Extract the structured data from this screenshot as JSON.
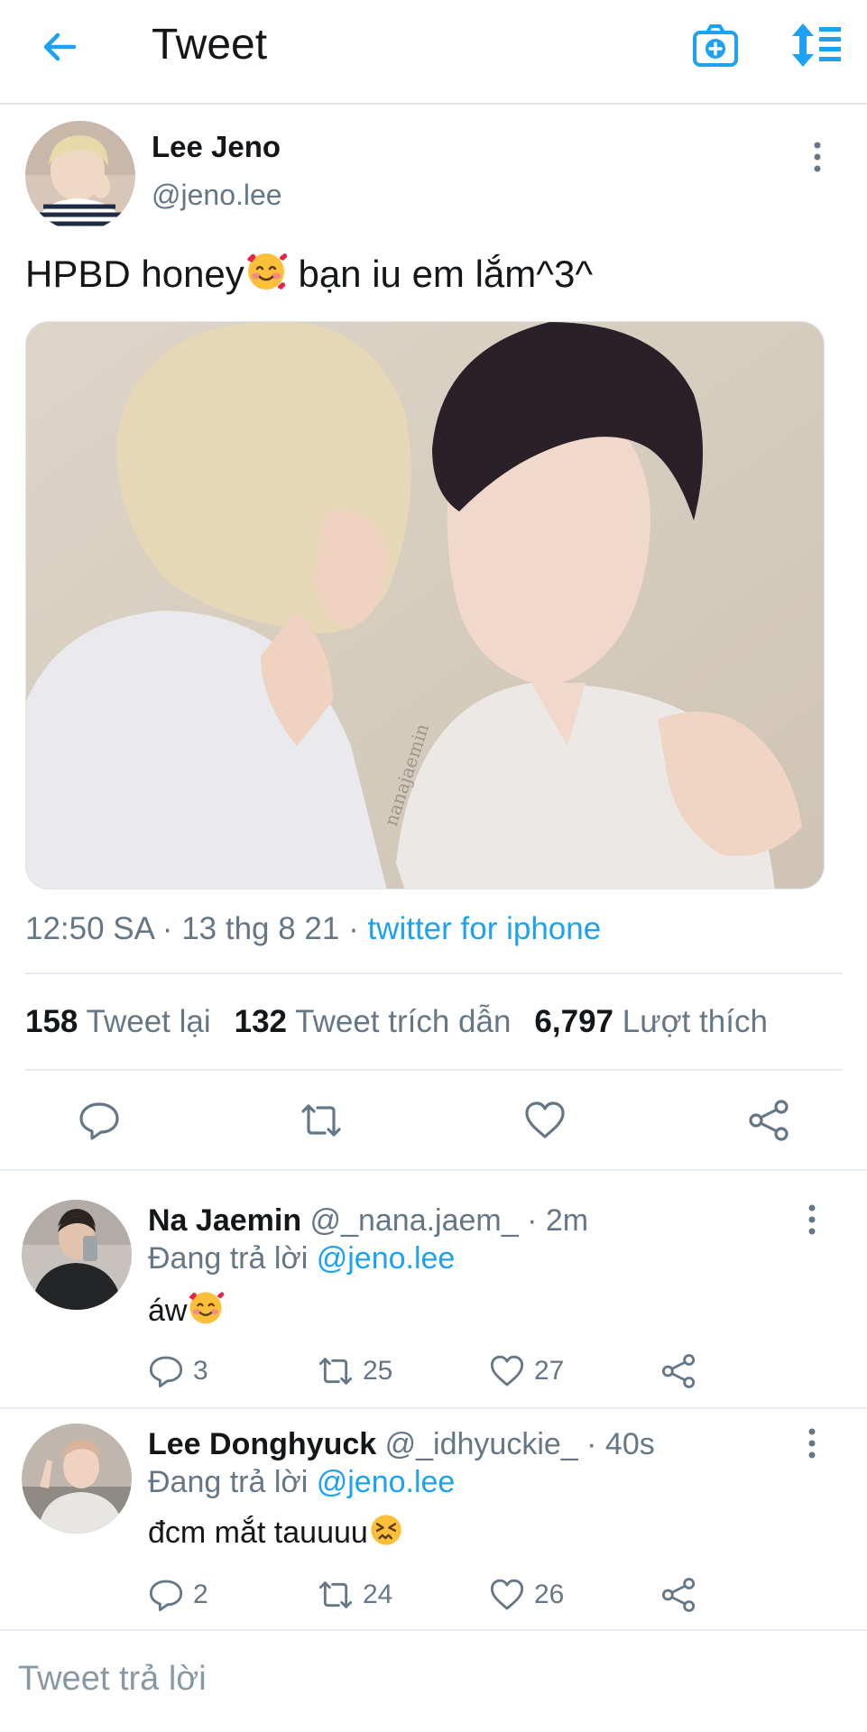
{
  "header": {
    "title": "Tweet",
    "icons": {
      "back": "back-arrow-icon",
      "camera": "camera-plus-icon",
      "sort": "sort-arrows-icon"
    }
  },
  "tweet": {
    "author_name": "Lee Jeno",
    "author_handle": "@jeno.lee",
    "text_before_emoji": "HPBD honey",
    "text_emoji": "smiling-face-with-hearts",
    "text_after_emoji": " bạn iu em lắm^3^",
    "media_watermark": "nanajaemin",
    "time": "12:50 SA",
    "date": "13 thg 8 21",
    "source": "twitter for iphone",
    "stats": {
      "retweets_count": "158",
      "retweets_label": "Tweet lại",
      "quotes_count": "132",
      "quotes_label": "Tweet trích dẫn",
      "likes_count": "6,797",
      "likes_label": "Lượt thích"
    }
  },
  "replies": [
    {
      "name": "Na Jaemin",
      "handle": "@_nana.jaem_",
      "time": "2m",
      "replying_to_label": "Đang trả lời",
      "replying_to_handle": "@jeno.lee",
      "text": "áw",
      "emoji": "smiling-face-with-hearts",
      "replies": "3",
      "retweets": "25",
      "likes": "27"
    },
    {
      "name": "Lee Donghyuck",
      "handle": "@_idhyuckie_",
      "time": "40s",
      "replying_to_label": "Đang trả lời",
      "replying_to_handle": "@jeno.lee",
      "text": "đcm mắt tauuuu",
      "emoji": "confounded-face",
      "replies": "2",
      "retweets": "24",
      "likes": "26"
    }
  ],
  "compose": {
    "placeholder": "Tweet trả lời"
  },
  "colors": {
    "accent": "#1da1f2",
    "muted": "#657786",
    "text": "#14171a",
    "divider": "#e6ecf0"
  }
}
